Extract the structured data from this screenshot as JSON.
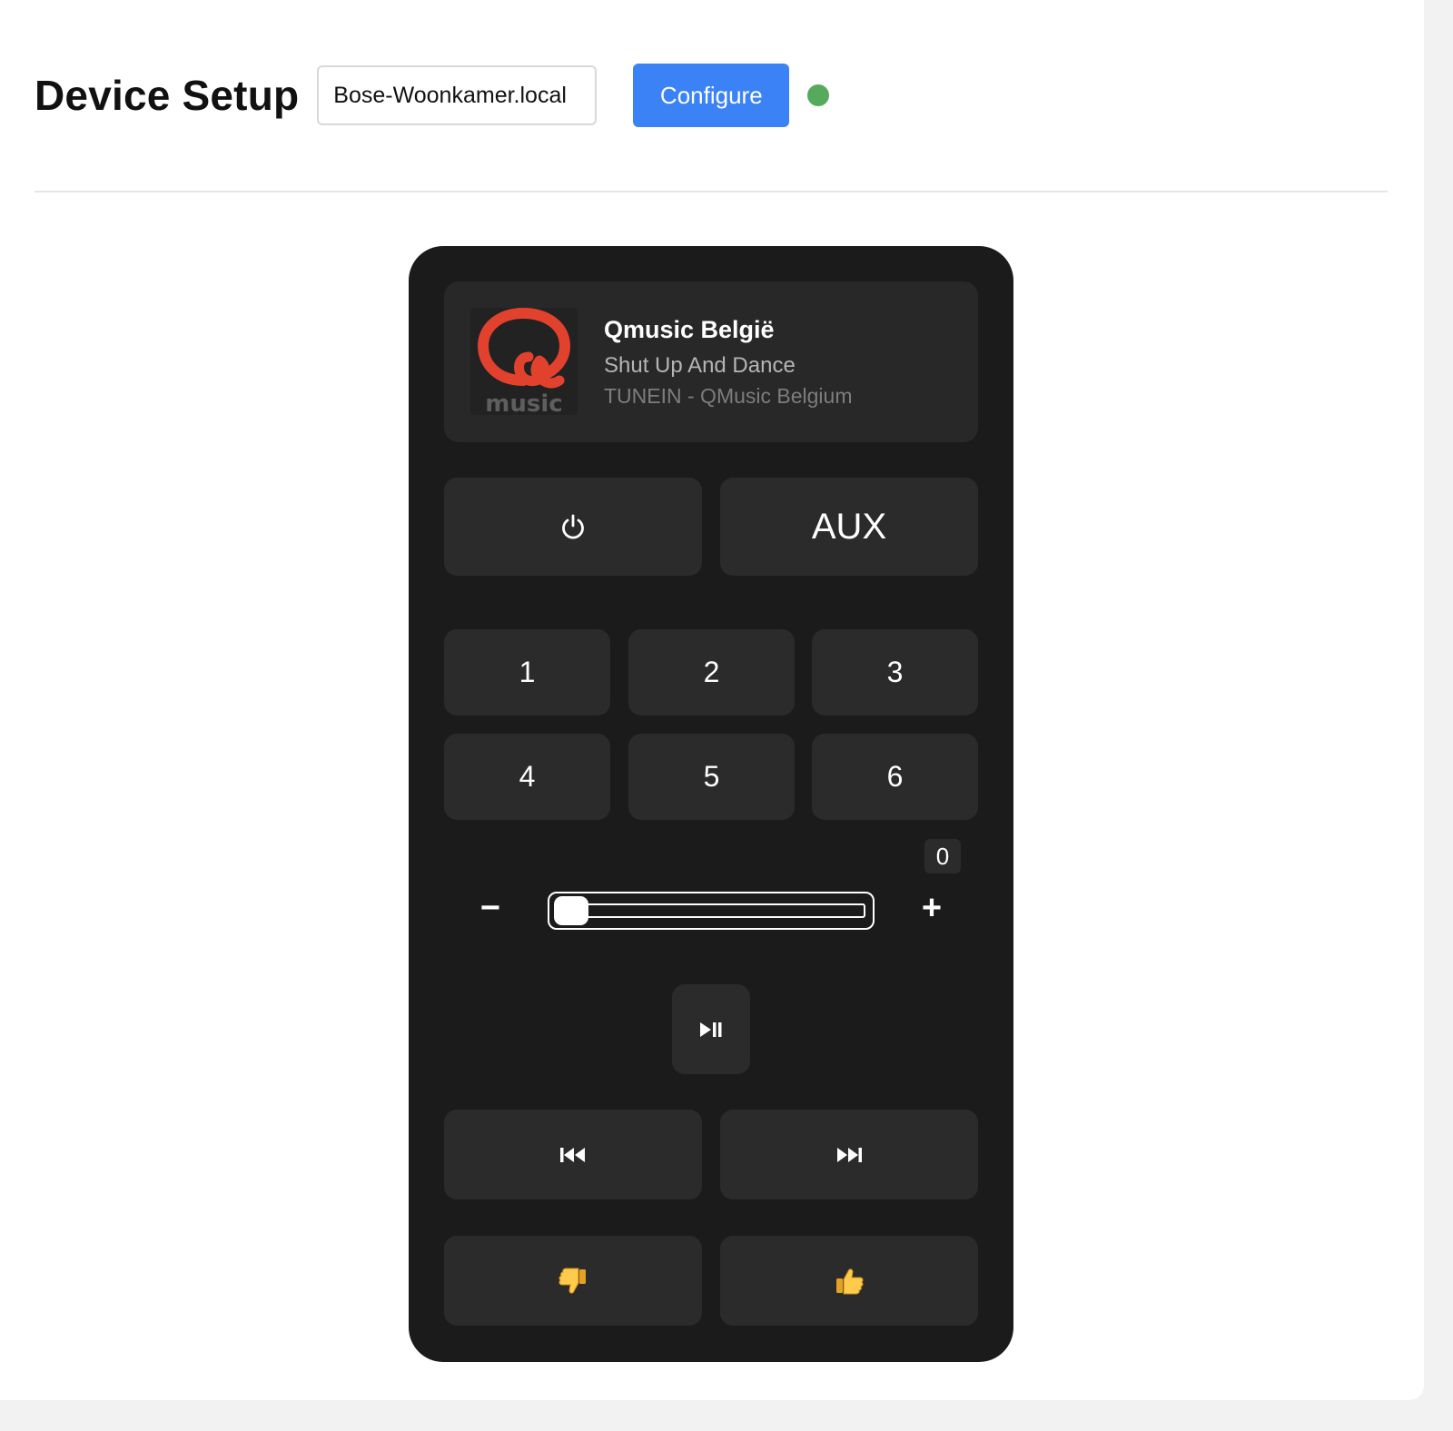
{
  "header": {
    "title": "Device Setup",
    "device_input_value": "Bose-Woonkamer.local",
    "configure_label": "Configure",
    "status_color": "#57a95b"
  },
  "now_playing": {
    "logo_icon": "qmusic-logo",
    "logo_text": "music",
    "station": "Qmusic België",
    "track": "Shut Up And Dance",
    "source": "TUNEIN - QMusic Belgium"
  },
  "controls": {
    "power_icon": "power-icon",
    "aux_label": "AUX",
    "presets": [
      "1",
      "2",
      "3",
      "4",
      "5",
      "6"
    ],
    "volume": {
      "value": "0",
      "decrease_label": "−",
      "increase_label": "+"
    },
    "play_pause_icon": "play-pause-icon",
    "previous_icon": "previous-track-icon",
    "next_icon": "next-track-icon",
    "thumbs_down_icon": "thumbs-down-icon",
    "thumbs_up_icon": "thumbs-up-icon"
  },
  "colors": {
    "accent": "#3b82f6",
    "remote_bg": "#1b1b1b",
    "button_bg": "#2b2b2b",
    "logo_red": "#e2422d"
  }
}
